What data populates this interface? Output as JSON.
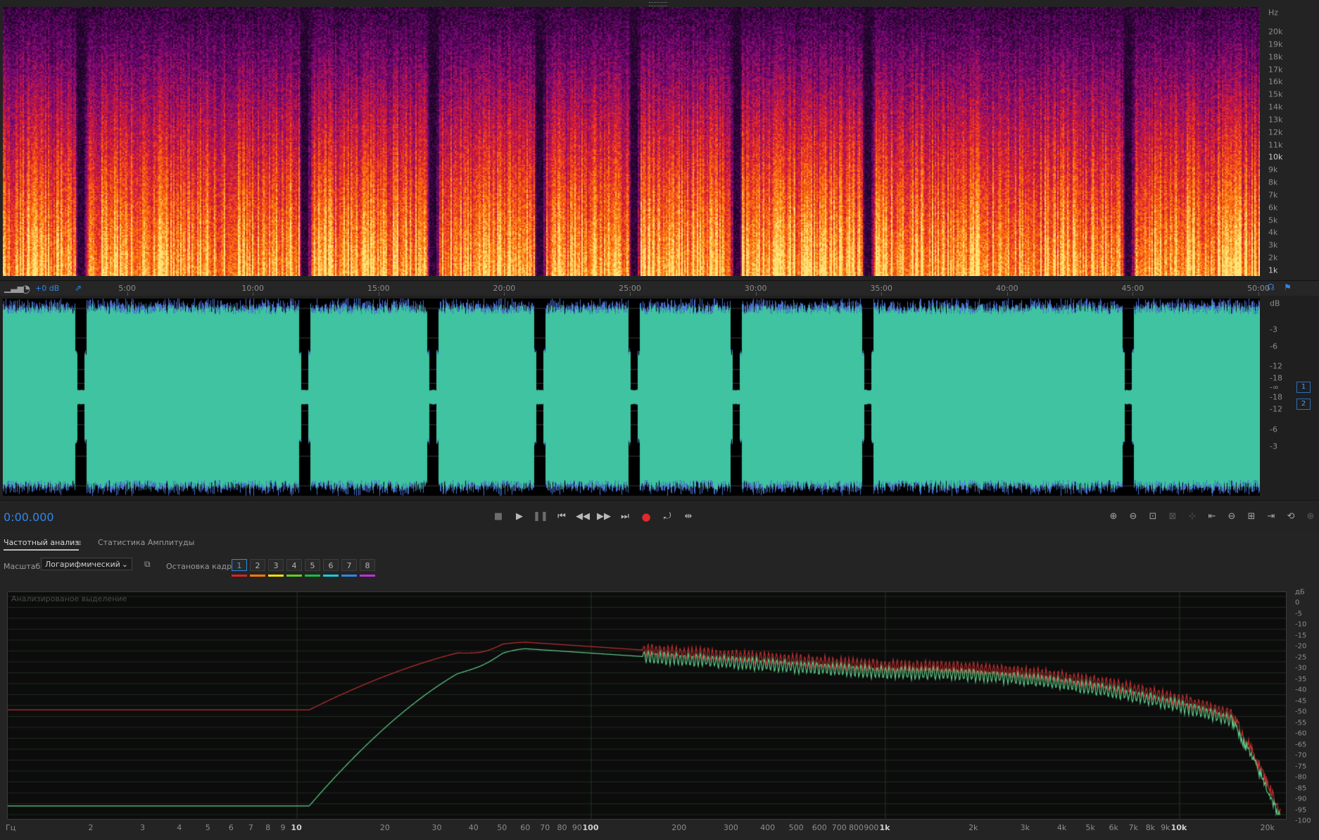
{
  "spectral": {
    "hz_unit": "Hz",
    "hz_labels": [
      "20k",
      "19k",
      "18k",
      "17k",
      "16k",
      "15k",
      "14k",
      "13k",
      "12k",
      "11k",
      "10k",
      "9k",
      "8k",
      "7k",
      "6k",
      "5k",
      "4k",
      "3k",
      "2k",
      "1k"
    ]
  },
  "timeline": {
    "gain_label": "+0 dB",
    "ticks": [
      "5:00",
      "10:00",
      "15:00",
      "20:00",
      "25:00",
      "30:00",
      "35:00",
      "40:00",
      "45:00",
      "50:00"
    ]
  },
  "waveform": {
    "db_unit": "dB",
    "db_labels": [
      "-3",
      "-6",
      "-12",
      "-18",
      "-∞",
      "-18",
      "-12",
      "-6",
      "-3"
    ],
    "channels": [
      "1",
      "2"
    ],
    "colors": {
      "wave": "#3fc3a1",
      "background": "#000000"
    }
  },
  "transport": {
    "timecode": "0:00.000",
    "buttons": [
      "stop-icon",
      "play-icon",
      "pause-icon",
      "go-to-start-icon",
      "rewind-icon",
      "fast-forward-icon",
      "go-to-end-icon",
      "record-icon",
      "loop-icon",
      "skip-selection-icon"
    ],
    "zoom_buttons": [
      "zoom-in-amplitude-icon",
      "zoom-out-amplitude-icon",
      "zoom-to-fit-icon",
      "zoom-selection-icon",
      "zoom-reset-icon",
      "zoom-in-left-icon",
      "zoom-out-icon",
      "zoom-full-icon",
      "zoom-in-right-icon",
      "zoom-time-icon",
      "zoom-extra-icon"
    ]
  },
  "panel": {
    "tabs": [
      "Частотный анализ",
      "Статистика Амплитуды"
    ],
    "scale_label": "Масштаб:",
    "scale_value": "Логарифмический",
    "freeze_label": "Остановка кадра:",
    "frames": [
      "1",
      "2",
      "3",
      "4",
      "5",
      "6",
      "7",
      "8"
    ],
    "frame_colors": [
      "#e02020",
      "#ff7a00",
      "#f5e100",
      "#62d11b",
      "#12c23c",
      "#12cfe0",
      "#2f87e8",
      "#c030e0"
    ],
    "analysis_caption": "Анализированое выделение",
    "freq_unit": "Гц",
    "freq_labels": [
      "2",
      "3",
      "4",
      "5",
      "6",
      "7",
      "8",
      "9",
      "10",
      "20",
      "30",
      "40",
      "50",
      "60",
      "70",
      "80",
      "90",
      "100",
      "200",
      "300",
      "400",
      "500",
      "600",
      "700",
      "800",
      "900",
      "1k",
      "2k",
      "3k",
      "4k",
      "5k",
      "6k",
      "7k",
      "8k",
      "9k",
      "10k",
      "20k"
    ],
    "db_unit": "дБ",
    "db_labels": [
      "0",
      "-5",
      "-10",
      "-15",
      "-20",
      "-25",
      "-30",
      "-35",
      "-40",
      "-45",
      "-50",
      "-55",
      "-60",
      "-65",
      "-70",
      "-75",
      "-80",
      "-85",
      "-90",
      "-95",
      "-100"
    ],
    "series_colors": {
      "left": "#c03030",
      "right": "#5fcf8a"
    }
  }
}
